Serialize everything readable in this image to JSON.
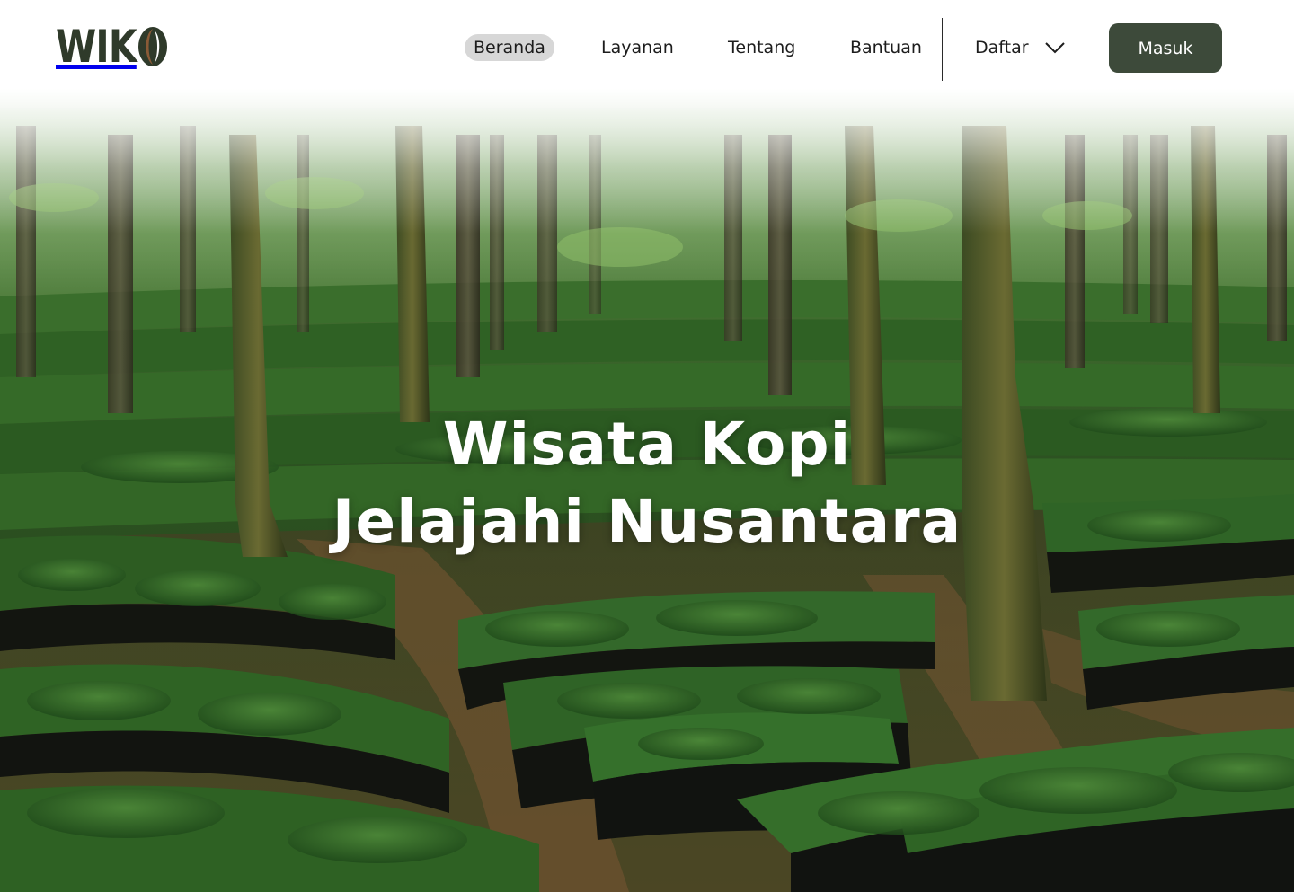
{
  "brand": {
    "name": "WIKO",
    "logo_letters": "WIK",
    "accent_bean": "#8a5a36"
  },
  "nav": {
    "items": [
      {
        "label": "Beranda",
        "active": true
      },
      {
        "label": "Layanan",
        "active": false
      },
      {
        "label": "Tentang",
        "active": false
      },
      {
        "label": "Bantuan",
        "active": false
      }
    ],
    "dropdown": {
      "label": "Daftar",
      "icon": "chevron-down-icon"
    },
    "login_label": "Masuk"
  },
  "hero": {
    "line1": "Wisata Kopi",
    "line2": "Jelajahi Nusantara",
    "image": "coffee-seedling-plantation-photo"
  },
  "colors": {
    "button_bg": "#3d4a3a",
    "active_pill": "#d7d7d7",
    "logo_text": "#2f3a2a"
  }
}
